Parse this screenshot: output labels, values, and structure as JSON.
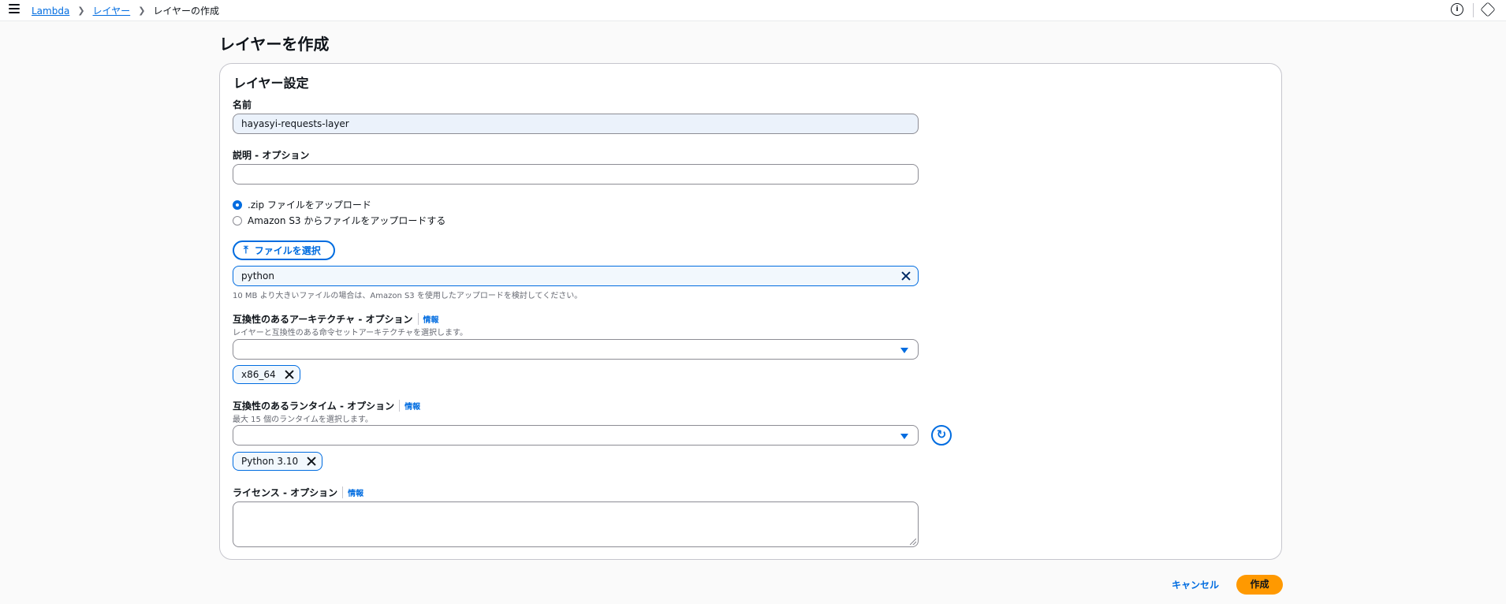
{
  "breadcrumb": {
    "items": [
      "Lambda",
      "レイヤー"
    ],
    "current": "レイヤーの作成"
  },
  "header_icons": [
    "info-icon",
    "settings-icon"
  ],
  "page": {
    "title": "レイヤーを作成"
  },
  "panel": {
    "title": "レイヤー設定",
    "name": {
      "label": "名前",
      "value": "hayasyi-requests-layer"
    },
    "description": {
      "label": "説明 - オプション",
      "value": ""
    },
    "upload_options": [
      {
        "label": ".zip ファイルをアップロード",
        "checked": true
      },
      {
        "label": "Amazon S3 からファイルをアップロードする",
        "checked": false
      }
    ],
    "file_button": "ファイルを選択",
    "file_name": "python",
    "file_hint": "10 MB より大きいファイルの場合は、Amazon S3 を使用したアップロードを検討してください。",
    "architecture": {
      "label": "互換性のあるアーキテクチャ - オプション",
      "info": "情報",
      "hint": "レイヤーと互換性のある命令セットアーキテクチャを選択します。",
      "selected_token": "x86_64"
    },
    "runtime": {
      "label": "互換性のあるランタイム - オプション",
      "info": "情報",
      "hint": "最大 15 個のランタイムを選択します。",
      "selected_token": "Python 3.10"
    },
    "license": {
      "label": "ライセンス - オプション",
      "info": "情報",
      "value": ""
    }
  },
  "actions": {
    "cancel": "キャンセル",
    "create": "作成"
  },
  "colors": {
    "accent": "#006ce0",
    "primary_button": "#ff9900"
  }
}
